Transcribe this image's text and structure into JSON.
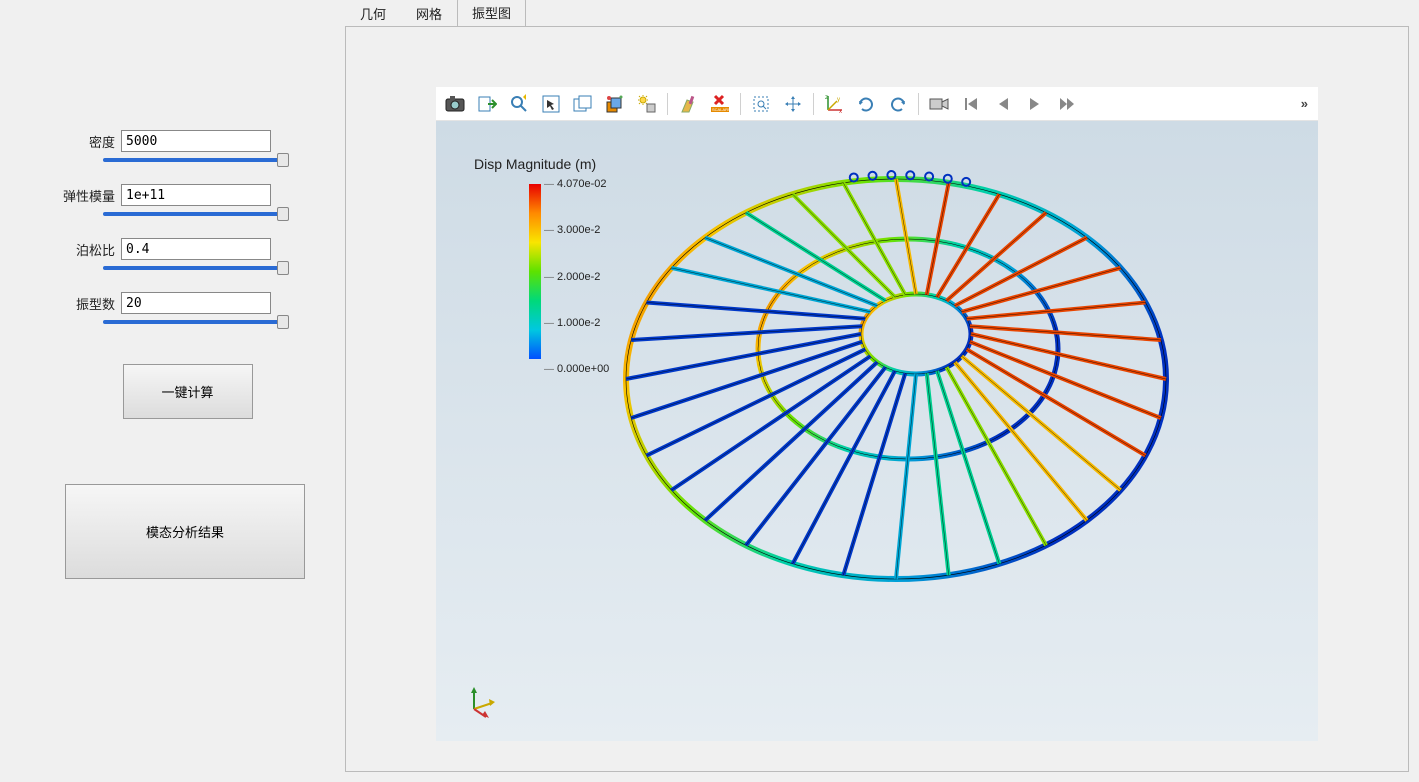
{
  "sidebar": {
    "params": {
      "density_label": "密度",
      "density_value": "5000",
      "modulus_label": "弹性模量",
      "modulus_value": "1e+11",
      "poisson_label": "泊松比",
      "poisson_value": "0.4",
      "modes_label": "振型数",
      "modes_value": "20"
    },
    "buttons": {
      "calculate": "一键计算",
      "results": "模态分析结果"
    }
  },
  "tabs": {
    "geometry": "几何",
    "mesh": "网格",
    "modeshape": "振型图",
    "active": "modeshape"
  },
  "toolbar": {
    "items": [
      "camera-icon",
      "export-icon",
      "zoom-fit-icon",
      "select-icon",
      "box-select-icon",
      "clip-plane-icon",
      "light-icon",
      "sep",
      "clear-icon",
      "remove-scalar-icon",
      "sep",
      "rubber-zoom-icon",
      "pan-icon",
      "sep",
      "axes-icon",
      "rotate-ccw-icon",
      "rotate-cw-icon",
      "sep",
      "record-icon",
      "first-frame-icon",
      "prev-frame-icon",
      "play-icon",
      "fast-forward-icon"
    ],
    "overflow": "»"
  },
  "legend": {
    "title": "Disp Magnitude (m)",
    "ticks": [
      {
        "pos": 0,
        "label": "4.070e-02"
      },
      {
        "pos": 25,
        "label": "3.000e-2"
      },
      {
        "pos": 50,
        "label": "2.000e-2"
      },
      {
        "pos": 75,
        "label": "1.000e-2"
      },
      {
        "pos": 100,
        "label": "0.000e+00"
      }
    ]
  }
}
